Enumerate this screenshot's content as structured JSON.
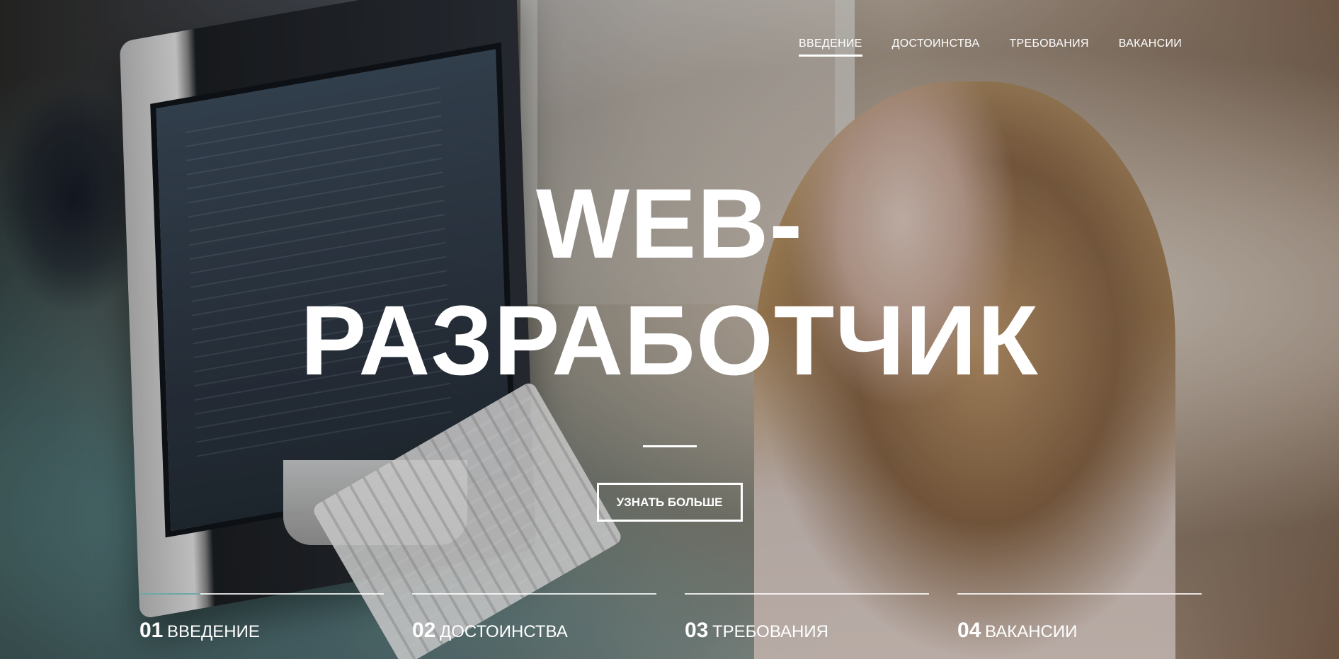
{
  "top_nav": {
    "items": [
      {
        "label": "ВВЕДЕНИЕ"
      },
      {
        "label": "ДОСТОИНСТВА"
      },
      {
        "label": "ТРЕБОВАНИЯ"
      },
      {
        "label": "ВАКАНСИИ"
      }
    ],
    "active_index": 0
  },
  "hero": {
    "title_line_1": "WEB-",
    "title_line_2": "РАЗРАБОТЧИК",
    "cta_label": "УЗНАТЬ БОЛЬШЕ"
  },
  "sections": [
    {
      "number": "01",
      "label": "ВВЕДЕНИЕ"
    },
    {
      "number": "02",
      "label": "ДОСТОИНСТВА"
    },
    {
      "number": "03",
      "label": "ТРЕБОВАНИЯ"
    },
    {
      "number": "04",
      "label": "ВАКАНСИИ"
    }
  ],
  "colors": {
    "text": "#ffffff",
    "accent": "#6fa7a4"
  }
}
